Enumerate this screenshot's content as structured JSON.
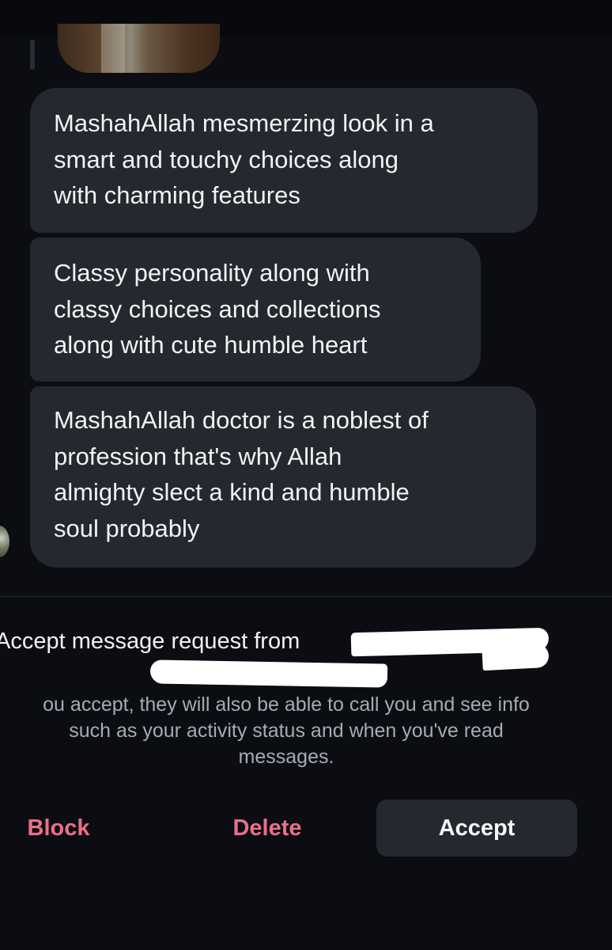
{
  "messages": [
    {
      "lines": [
        "MashahAllah mesmerzing look in a",
        "smart and touchy choices along",
        "with charming features"
      ]
    },
    {
      "lines": [
        "Classy personality along with",
        "classy choices and collections",
        "along with cute humble heart"
      ]
    },
    {
      "lines": [
        "MashahAllah doctor is a noblest of",
        "profession that's why Allah",
        "almighty slect a kind and humble",
        "soul probably"
      ]
    }
  ],
  "request": {
    "title": "Accept message request from",
    "info_lines": [
      "ou accept, they will also be able to call you and see info",
      "such as your activity status and when you've read",
      "messages."
    ]
  },
  "actions": {
    "block_label": "Block",
    "delete_label": "Delete",
    "accept_label": "Accept"
  },
  "colors": {
    "background": "#0b0d12",
    "bubble": "#25282e",
    "danger_text": "#ec6f89",
    "secondary_text": "#a7abb2"
  }
}
